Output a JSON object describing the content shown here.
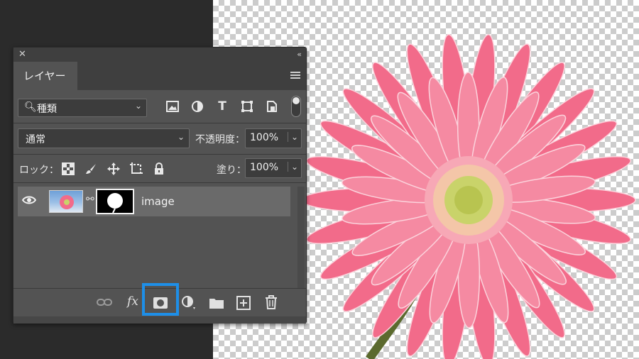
{
  "panel": {
    "close_glyph": "✕",
    "collapse_glyph": "‹‹",
    "tab_label": "レイヤー"
  },
  "filter": {
    "kind_value": "種類",
    "icons": [
      "image-filter-icon",
      "adjustment-filter-icon",
      "type-filter-icon",
      "shape-filter-icon",
      "smart-object-filter-icon"
    ],
    "type_glyph": "T"
  },
  "blend": {
    "mode_value": "通常",
    "opacity_label": "不透明度：",
    "opacity_value": "100%"
  },
  "lock": {
    "label": "ロック：",
    "fill_label": "塗り：",
    "fill_value": "100%"
  },
  "layers": [
    {
      "name": "image",
      "visible": true
    }
  ],
  "bottom": {
    "fx_label": "fx"
  },
  "colors": {
    "highlight": "#1e8fe8",
    "panel_bg": "#535353",
    "flower_petal": "#f26b8a",
    "flower_center": "#c9d36a"
  }
}
